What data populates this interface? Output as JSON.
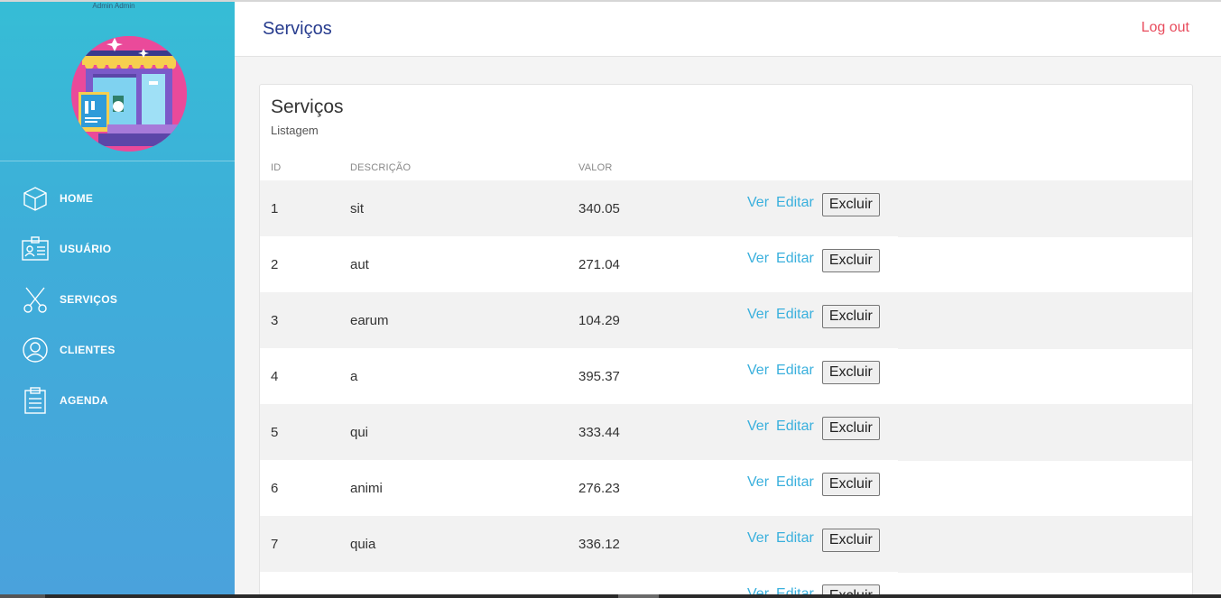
{
  "sidebar": {
    "admin_name": "Admin Admin",
    "items": [
      {
        "label": "HOME",
        "icon": "cube-icon"
      },
      {
        "label": "USUÁRIO",
        "icon": "id-card-icon"
      },
      {
        "label": "SERVIÇOS",
        "icon": "scissors-icon"
      },
      {
        "label": "CLIENTES",
        "icon": "user-circle-icon"
      },
      {
        "label": "AGENDA",
        "icon": "clipboard-icon"
      }
    ]
  },
  "header": {
    "title": "Serviços",
    "logout_label": "Log out"
  },
  "card": {
    "title": "Serviços",
    "subtitle": "Listagem"
  },
  "table": {
    "columns": [
      "ID",
      "DESCRIÇÃO",
      "VALOR"
    ],
    "rows": [
      {
        "id": "1",
        "descricao": "sit",
        "valor": "340.05"
      },
      {
        "id": "2",
        "descricao": "aut",
        "valor": "271.04"
      },
      {
        "id": "3",
        "descricao": "earum",
        "valor": "104.29"
      },
      {
        "id": "4",
        "descricao": "a",
        "valor": "395.37"
      },
      {
        "id": "5",
        "descricao": "qui",
        "valor": "333.44"
      },
      {
        "id": "6",
        "descricao": "animi",
        "valor": "276.23"
      },
      {
        "id": "7",
        "descricao": "quia",
        "valor": "336.12"
      },
      {
        "id": "",
        "descricao": "",
        "valor": ""
      }
    ],
    "actions": {
      "view": "Ver",
      "edit": "Editar",
      "delete": "Excluir"
    }
  },
  "colors": {
    "sidebar_top": "#36bdd6",
    "sidebar_bottom": "#4aa2dc",
    "title_blue": "#273c8e",
    "logout_red": "#e84b5c",
    "link_blue": "#3ab0dd",
    "avatar_pink": "#ea4a9a"
  }
}
